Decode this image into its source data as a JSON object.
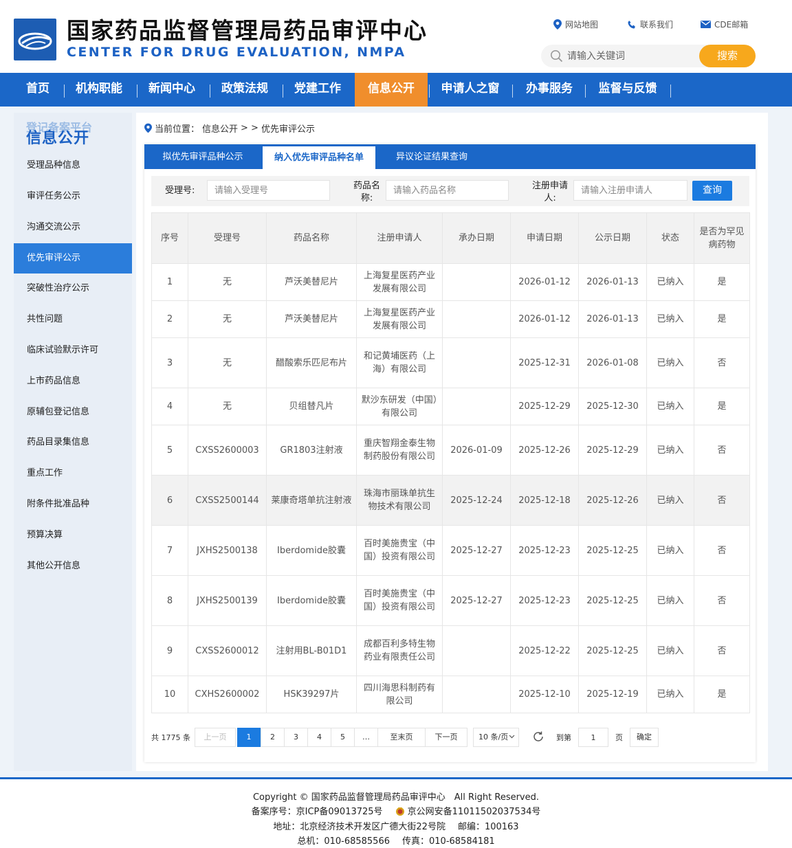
{
  "header": {
    "title": "国家药品监督管理局药品审评中心",
    "subtitle": "CENTER FOR DRUG EVALUATION, NMPA",
    "links": {
      "sitemap": "网站地图",
      "contact": "联系我们",
      "mail": "CDE邮箱"
    },
    "search_placeholder": "请输入关键词",
    "search_button": "搜索"
  },
  "nav": {
    "items": [
      "首页",
      "机构职能",
      "新闻中心",
      "政策法规",
      "党建工作",
      "信息公开",
      "申请人之窗",
      "办事服务",
      "监督与反馈"
    ],
    "active": "信息公开"
  },
  "sidebar": {
    "ghost_text": "登记备案平台",
    "title": "信息公开",
    "items": [
      "受理品种信息",
      "审评任务公示",
      "沟通交流公示",
      "优先审评公示",
      "突破性治疗公示",
      "共性问题",
      "临床试验默示许可",
      "上市药品信息",
      "原辅包登记信息",
      "药品目录集信息",
      "重点工作",
      "附条件批准品种",
      "预算决算",
      "其他公开信息"
    ],
    "active": "优先审评公示"
  },
  "breadcrumb": {
    "prefix": "当前位置：",
    "level1": "信息公开",
    "sep": "> >",
    "level2": "优先审评公示"
  },
  "tabs": [
    "拟优先审评品种公示",
    "纳入优先审评品种名单",
    "异议论证结果查询"
  ],
  "active_tab": "纳入优先审评品种名单",
  "filter": {
    "accept_label": "受理号:",
    "accept_placeholder": "请输入受理号",
    "drug_label_1": "药品名",
    "drug_label_2": "称:",
    "drug_placeholder": "请输入药品名称",
    "applicant_label_1": "注册申请",
    "applicant_label_2": "人:",
    "applicant_placeholder": "请输入注册申请人",
    "query_button": "查询"
  },
  "table": {
    "columns": [
      "序号",
      "受理号",
      "药品名称",
      "注册申请人",
      "承办日期",
      "申请日期",
      "公示日期",
      "状态",
      "是否为罕见病药物"
    ],
    "rows": [
      [
        "1",
        "无",
        "芦沃美替尼片",
        "上海复星医药产业发展有限公司",
        "",
        "2026-01-12",
        "2026-01-13",
        "已纳入",
        "是"
      ],
      [
        "2",
        "无",
        "芦沃美替尼片",
        "上海复星医药产业发展有限公司",
        "",
        "2026-01-12",
        "2026-01-13",
        "已纳入",
        "是"
      ],
      [
        "3",
        "无",
        "醋酸索乐匹尼布片",
        "和记黄埔医药（上海）有限公司",
        "",
        "2025-12-31",
        "2026-01-08",
        "已纳入",
        "否"
      ],
      [
        "4",
        "无",
        "贝组替凡片",
        "默沙东研发（中国）有限公司",
        "",
        "2025-12-29",
        "2025-12-30",
        "已纳入",
        "是"
      ],
      [
        "5",
        "CXSS2600003",
        "GR1803注射液",
        "重庆智翔金泰生物制药股份有限公司",
        "2026-01-09",
        "2025-12-26",
        "2025-12-29",
        "已纳入",
        "否"
      ],
      [
        "6",
        "CXSS2500144",
        "莱康奇塔单抗注射液",
        "珠海市丽珠单抗生物技术有限公司",
        "2025-12-24",
        "2025-12-18",
        "2025-12-26",
        "已纳入",
        "否"
      ],
      [
        "7",
        "JXHS2500138",
        "Iberdomide胶囊",
        "百时美施贵宝（中国）投资有限公司",
        "2025-12-27",
        "2025-12-23",
        "2025-12-25",
        "已纳入",
        "否"
      ],
      [
        "8",
        "JXHS2500139",
        "Iberdomide胶囊",
        "百时美施贵宝（中国）投资有限公司",
        "2025-12-27",
        "2025-12-23",
        "2025-12-25",
        "已纳入",
        "否"
      ],
      [
        "9",
        "CXSS2600012",
        "注射用BL-B01D1",
        "成都百利多特生物药业有限责任公司",
        "",
        "2025-12-22",
        "2025-12-25",
        "已纳入",
        "否"
      ],
      [
        "10",
        "CXHS2600002",
        "HSK39297片",
        "四川海思科制药有限公司",
        "",
        "2025-12-10",
        "2025-12-19",
        "已纳入",
        "是"
      ]
    ],
    "highlighted_row": 6
  },
  "pagination": {
    "total": "共 1775 条",
    "prev": "上一页",
    "pages": [
      "1",
      "2",
      "3",
      "4",
      "5"
    ],
    "ellipsis": "…",
    "last": "至末页",
    "next": "下一页",
    "page_size": "10 条/页",
    "goto_label": "到第",
    "goto_value": "1",
    "page_unit": "页",
    "confirm": "确定",
    "current_page": 1
  },
  "footer": {
    "copyright": "Copyright © 国家药品监督管理局药品审评中心　All Right Reserved.",
    "icp": "备案序号：京ICP备09013725号",
    "police": "京公网安备11011502037534号",
    "address": "地址：北京经济技术开发区广德大街22号院",
    "postcode": "邮编：100163",
    "phone": "总机：010-68585566",
    "fax": "传真：010-68584181"
  },
  "colors": {
    "brand_blue": "#1b67c8",
    "nav_active": "#f08e2c",
    "search_button": "#f7a81c",
    "sidebar_active": "#2b7ddb"
  }
}
